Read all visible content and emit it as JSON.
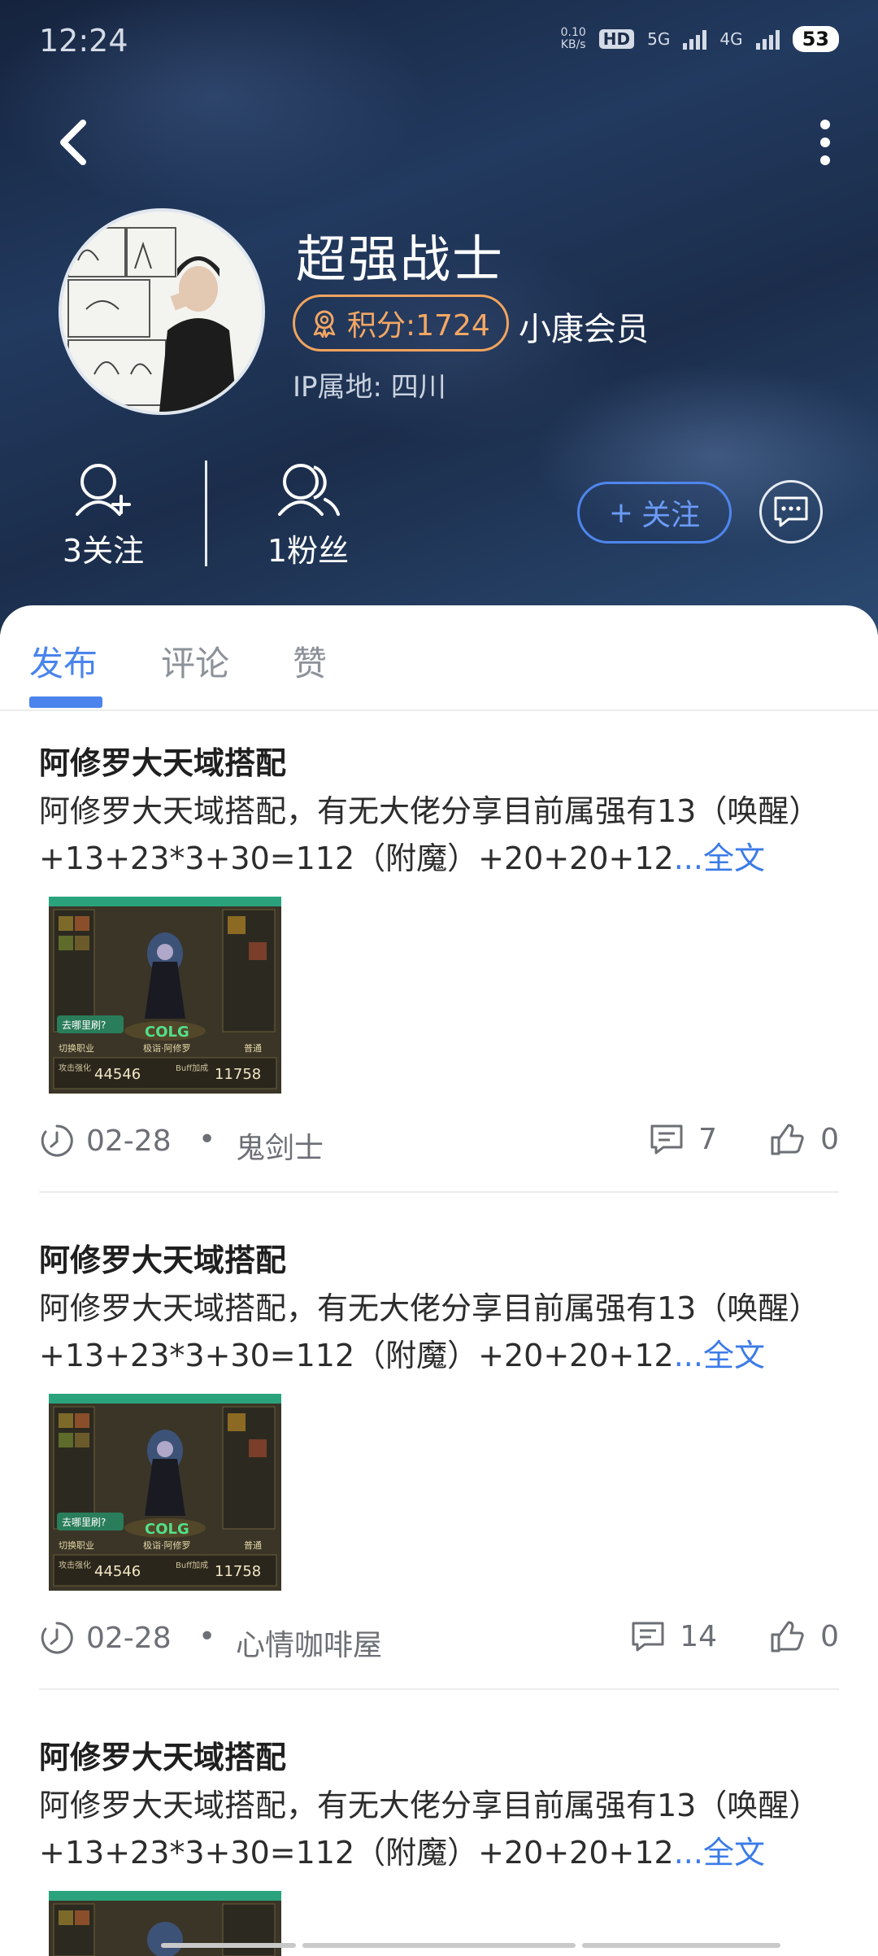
{
  "status": {
    "time": "12:24",
    "speed_top": "0.10",
    "speed_unit": "KB/s",
    "hd": "HD",
    "net1": "5G",
    "net2": "4G",
    "battery": "53"
  },
  "profile": {
    "name": "超强战士",
    "points": "积分:1724",
    "member": "小康会员",
    "ip": "IP属地: 四川"
  },
  "stats": {
    "following": "3关注",
    "fans": "1粉丝"
  },
  "actions": {
    "follow": "关注",
    "follow_prefix": "+"
  },
  "tabs": [
    "发布",
    "评论",
    "赞"
  ],
  "posts": [
    {
      "title": "阿修罗大天域搭配",
      "body": "阿修罗大天域搭配，有无大佬分享目前属强有13（唤醒）+13+23*3+30=112（附魔）+20+20+12",
      "more": "...全文",
      "thumb": {
        "attack_label": "攻击强化",
        "attack": "44546",
        "buff_label": "Buff加成",
        "buff": "11758",
        "brand": "COLG",
        "name": "极诣·阿修罗",
        "btn": "去哪里刷?",
        "switch": "切换职业",
        "mode": "普通"
      },
      "date": "02-28",
      "author": "鬼剑士",
      "comments": "7",
      "likes": "0"
    },
    {
      "title": "阿修罗大天域搭配",
      "body": "阿修罗大天域搭配，有无大佬分享目前属强有13（唤醒）+13+23*3+30=112（附魔）+20+20+12",
      "more": "...全文",
      "thumb": {
        "attack_label": "攻击强化",
        "attack": "44546",
        "buff_label": "Buff加成",
        "buff": "11758",
        "brand": "COLG",
        "name": "极诣·阿修罗",
        "btn": "去哪里刷?",
        "switch": "切换职业",
        "mode": "普通"
      },
      "date": "02-28",
      "author": "心情咖啡屋",
      "comments": "14",
      "likes": "0"
    },
    {
      "title": "阿修罗大天域搭配",
      "body": "阿修罗大天域搭配，有无大佬分享目前属强有13（唤醒）+13+23*3+30=112（附魔）+20+20+12",
      "more": "...全文"
    }
  ],
  "colors": {
    "accent": "#4a84ec",
    "points": "#f0a35e",
    "header_dark": "#1b2d4b"
  }
}
